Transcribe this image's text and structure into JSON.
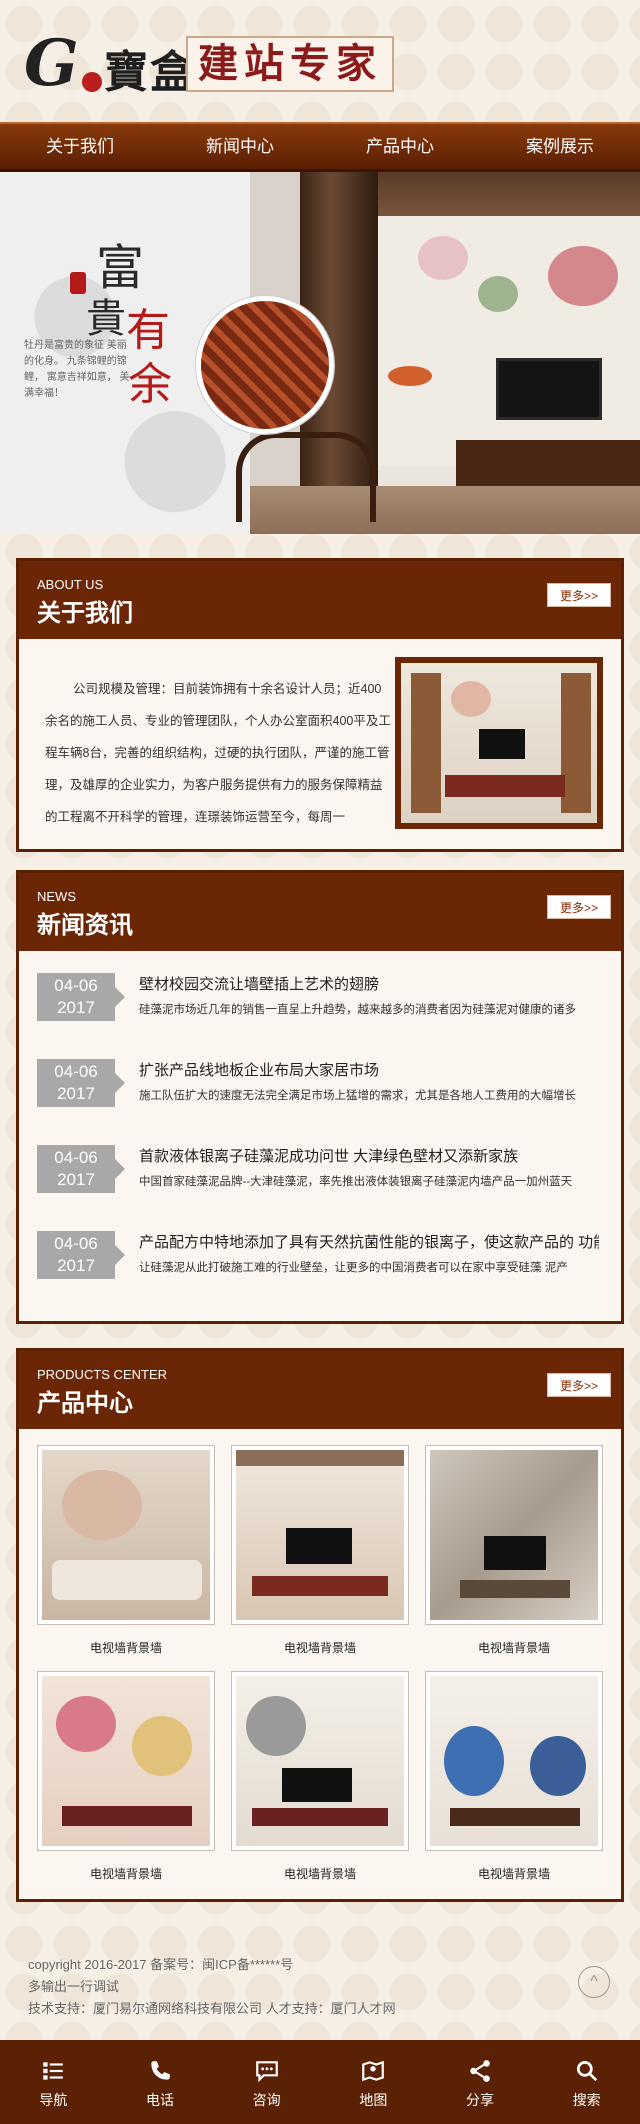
{
  "header": {
    "logo_letter": "G",
    "logo_brand": "寶盒",
    "logo_slogan": "建站专家"
  },
  "nav": {
    "items": [
      "关于我们",
      "新闻中心",
      "产品中心",
      "案例展示"
    ]
  },
  "banner": {
    "calligraphy_1": "富",
    "calligraphy_2": "貴",
    "calligraphy_3": "有",
    "calligraphy_4": "余",
    "poem": "牡丹是富贵的象征 美丽的化身。 九条锦鲤的锦鲤， 寓意吉祥如意， 美满幸福！"
  },
  "about": {
    "title_en": "ABOUT US",
    "title_cn": "关于我们",
    "more": "更多>>",
    "text": "公司规模及管理：目前装饰拥有十余名设计人员；近400余名的施工人员、专业的管理团队，个人办公室面积400平及工程车辆8台，完善的组织结构，过硬的执行团队，严谨的施工管理，及雄厚的企业实力，为客户服务提供有力的服务保障精益的工程离不开科学的管理，连璟装饰运营至今，每周一"
  },
  "news": {
    "title_en": "NEWS",
    "title_cn": "新闻资讯",
    "more": "更多>>",
    "items": [
      {
        "date": "04-06",
        "year": "2017",
        "title": "壁材校园交流让墙壁插上艺术的翅膀",
        "desc": "硅藻泥市场近几年的销售一直呈上升趋势，越来越多的消费者因为硅藻泥对健康的诸多"
      },
      {
        "date": "04-06",
        "year": "2017",
        "title": "扩张产品线地板企业布局大家居市场",
        "desc": "施工队伍扩大的速度无法完全满足市场上猛增的需求，尤其是各地人工费用的大幅增长"
      },
      {
        "date": "04-06",
        "year": "2017",
        "title": "首款液体银离子硅藻泥成功问世 大津绿色壁材又添新家族",
        "desc": "中国首家硅藻泥品牌--大津硅藻泥，率先推出液体装银离子硅藻泥内墙产品一加州蓝天"
      },
      {
        "date": "04-06",
        "year": "2017",
        "title": "产品配方中特地添加了具有天然抗菌性能的银离子，使这款产品的 功能",
        "desc": "让硅藻泥从此打破施工难的行业壁垒，让更多的中国消费者可以在家中享受硅藻 泥产"
      }
    ]
  },
  "products": {
    "title_en": "PRODUCTS CENTER",
    "title_cn": "产品中心",
    "more": "更多>>",
    "items": [
      {
        "label": "电视墙背景墙"
      },
      {
        "label": "电视墙背景墙"
      },
      {
        "label": "电视墙背景墙"
      },
      {
        "label": "电视墙背景墙"
      },
      {
        "label": "电视墙背景墙"
      },
      {
        "label": "电视墙背景墙"
      }
    ]
  },
  "footer": {
    "copyright": "copyright 2016-2017 备案号：闽ICP备******号",
    "line2": "多输出一行调试",
    "support": "技术支持：厦门易尔通网络科技有限公司 人才支持：厦门人才网",
    "top_button": "^"
  },
  "bottom_bar": {
    "items": [
      {
        "label": "导航",
        "icon": "menu-icon"
      },
      {
        "label": "电话",
        "icon": "phone-icon"
      },
      {
        "label": "咨询",
        "icon": "chat-icon"
      },
      {
        "label": "地图",
        "icon": "map-icon"
      },
      {
        "label": "分享",
        "icon": "share-icon"
      },
      {
        "label": "搜索",
        "icon": "search-icon"
      }
    ]
  },
  "colors": {
    "brand": "#6b2605",
    "nav": "#8a3a0c",
    "date_badge": "#a8a8a8",
    "accent_red": "#b31b1b"
  }
}
